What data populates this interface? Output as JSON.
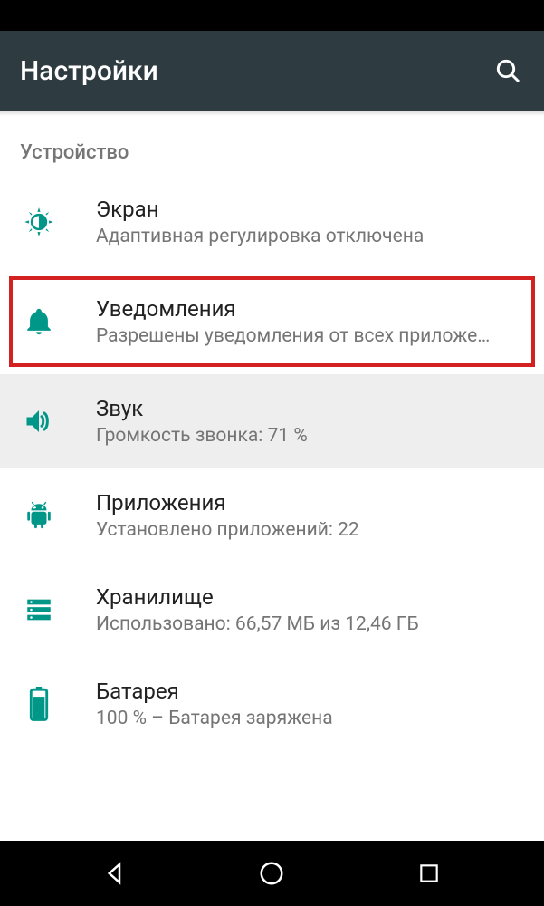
{
  "header": {
    "title": "Настройки"
  },
  "section": {
    "label": "Устройство"
  },
  "items": [
    {
      "title": "Экран",
      "subtitle": "Адаптивная регулировка отключена"
    },
    {
      "title": "Уведомления",
      "subtitle": "Разрешены уведомления от всех приложе…"
    },
    {
      "title": "Звук",
      "subtitle": "Громкость звонка: 71 %"
    },
    {
      "title": "Приложения",
      "subtitle": "Установлено приложений: 22"
    },
    {
      "title": "Хранилище",
      "subtitle": "Использовано: 66,57 МБ из 12,46 ГБ"
    },
    {
      "title": "Батарея",
      "subtitle": "100 % – Батарея заряжена"
    }
  ]
}
